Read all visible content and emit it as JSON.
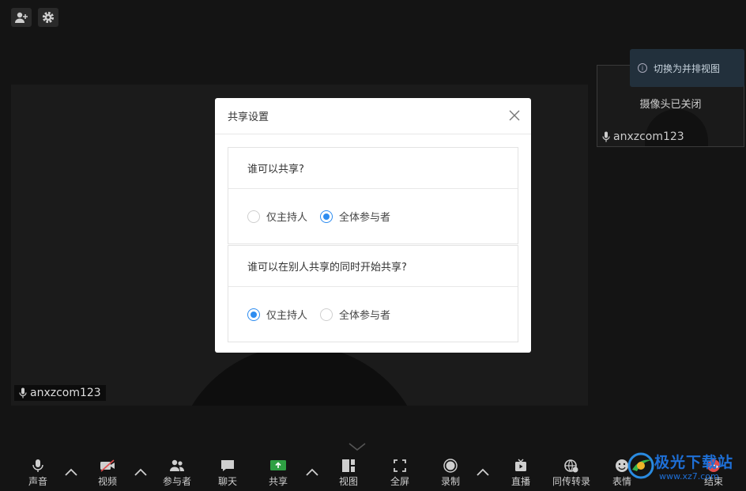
{
  "main_video": {
    "participant_name": "anxzcom123"
  },
  "thumbnail": {
    "camera_status": "摄像头已关闭",
    "participant_name": "anxzcom123",
    "switch_tip": "切换为并排视图"
  },
  "modal": {
    "title": "共享设置",
    "sections": [
      {
        "question": "谁可以共享?",
        "options": [
          {
            "label": "仅主持人",
            "checked": false
          },
          {
            "label": "全体参与者",
            "checked": true
          }
        ]
      },
      {
        "question": "谁可以在别人共享的同时开始共享?",
        "options": [
          {
            "label": "仅主持人",
            "checked": true
          },
          {
            "label": "全体参与者",
            "checked": false
          }
        ]
      }
    ]
  },
  "toolbar": {
    "items": [
      {
        "label": "声音",
        "icon": "microphone-icon"
      },
      {
        "label": "视频",
        "icon": "video-off-icon"
      },
      {
        "label": "参与者",
        "icon": "participants-icon"
      },
      {
        "label": "聊天",
        "icon": "chat-icon"
      },
      {
        "label": "共享",
        "icon": "share-screen-icon"
      },
      {
        "label": "视图",
        "icon": "view-layout-icon"
      },
      {
        "label": "全屏",
        "icon": "fullscreen-icon"
      },
      {
        "label": "录制",
        "icon": "record-icon"
      },
      {
        "label": "直播",
        "icon": "live-icon"
      },
      {
        "label": "同传转录",
        "icon": "transcribe-icon"
      },
      {
        "label": "表情",
        "icon": "emoji-icon"
      },
      {
        "label": "结束",
        "icon": "end-call-icon"
      }
    ]
  },
  "watermark": {
    "text": "极光下载站",
    "url": "www.xz7.com"
  },
  "colors": {
    "accent": "#2d8cf0",
    "share_green": "#2ea043",
    "end_red": "#e24b4b"
  }
}
